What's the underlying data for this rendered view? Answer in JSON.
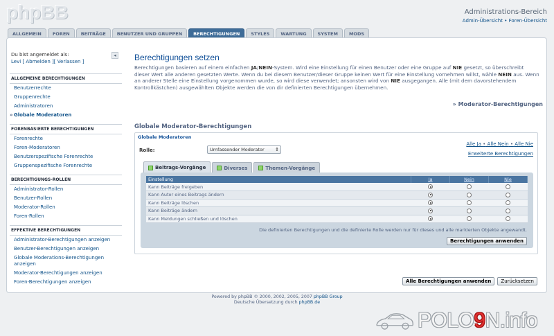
{
  "header": {
    "logo": "phpBB",
    "admin_title": "Administrations-Bereich",
    "admin_links": "Admin-Übersicht • Foren-Übersicht"
  },
  "tabs": [
    "Allgemein",
    "Foren",
    "Beiträge",
    "Benutzer und Gruppen",
    "Berechtigungen",
    "Styles",
    "Wartung",
    "System",
    "Mods"
  ],
  "active_tab": "Berechtigungen",
  "sidebar": {
    "logged_in_label": "Du bist angemeldet als:",
    "user_name": "Levi",
    "user_links": "[ Abmelden ][ Verlassen ]",
    "sections": [
      {
        "header": "Allgemeine Berechtigungen",
        "items": [
          "Benutzerrechte",
          "Gruppenrechte",
          "Administratoren",
          "Globale Moderatoren"
        ]
      },
      {
        "header": "Forenbasierte Berechtigungen",
        "items": [
          "Forenrechte",
          "Foren-Moderatoren",
          "Benutzerspezifische Forenrechte",
          "Gruppenspezifische Forenrechte"
        ]
      },
      {
        "header": "Berechtigungs-Rollen",
        "items": [
          "Administrator-Rollen",
          "Benutzer-Rollen",
          "Moderator-Rollen",
          "Foren-Rollen"
        ]
      },
      {
        "header": "Effektive Berechtigungen",
        "items": [
          "Administrator-Berechtigungen anzeigen",
          "Benutzer-Berechtigungen anzeigen",
          "Globale Moderations-Berechtigungen anzeigen",
          "Moderator-Berechtigungen anzeigen",
          "Foren-Berechtigungen anzeigen"
        ]
      }
    ],
    "active_item": "Globale Moderatoren"
  },
  "main": {
    "title": "Berechtigungen setzen",
    "desc_1": "Berechtigungen basieren auf einem einfachen ",
    "desc_b1": "JA",
    "desc_2": "/",
    "desc_b2": "NEIN",
    "desc_3": "-System. Wird eine Einstellung für einen Benutzer oder eine Gruppe auf ",
    "desc_b3": "NIE",
    "desc_4": " gesetzt, so überschreibt dieser Wert alle anderen gesetzten Werte. Wenn du bei diesem Benutzer/dieser Gruppe keinen Wert für eine Einstellung vornehmen willst, wähle ",
    "desc_b4": "NEIN",
    "desc_5": " aus. Wenn an anderer Stelle eine Einstellung vorgenommen wurde, so wird diese verwendet; ansonsten wird von ",
    "desc_b5": "NIE",
    "desc_6": " ausgegangen. Alle (mit dem davorstehendem Kontrollkästchen) ausgewählten Objekte werden die von dir definierten Berechtigungen übernehmen.",
    "mod_link": "» Moderator-Berechtigungen",
    "section_title": "Globale Moderator-Berechtigungen",
    "legend": "Globale Moderatoren",
    "role_label": "Rolle:",
    "role_value": "Umfassender Moderator",
    "quick_all_yes": "Alle Ja",
    "quick_all_no": "Alle Nein",
    "quick_all_never": "Alle Nie",
    "quick_sep": "•",
    "advanced_link": "Erweiterte Berechtigungen",
    "subtabs": [
      "Beitrags-Vorgänge",
      "Diverses",
      "Themen-Vorgänge"
    ],
    "table_headers": {
      "setting": "Einstellung",
      "yes": "Ja",
      "no": "Nein",
      "never": "Nie"
    },
    "rows": [
      {
        "label": "Kann Beiträge freigeben",
        "selected": "yes"
      },
      {
        "label": "Kann Autor eines Beitrags ändern",
        "selected": "yes"
      },
      {
        "label": "Kann Beiträge löschen",
        "selected": "yes"
      },
      {
        "label": "Kann Beiträge ändern",
        "selected": "yes"
      },
      {
        "label": "Kann Meldungen schließen und löschen",
        "selected": "yes"
      }
    ],
    "note": "Die definierten Berechtigungen und die definierte Rolle werden nur für dieses und alle markierten Objekte angewandt.",
    "apply_button": "Berechtigungen anwenden",
    "apply_all_button": "Alle Berechtigungen anwenden",
    "reset_button": "Zurücksetzen"
  },
  "footer": {
    "line1_pre": "Powered by phpBB © 2000, 2002, 2005, 2007 ",
    "line1_link": "phpBB Group",
    "line2_pre": "Deutsche Übersetzung durch ",
    "line2_link": "phpBB.de"
  },
  "watermark": {
    "pre": "POLO",
    "red": "9",
    "post": "N.info"
  }
}
